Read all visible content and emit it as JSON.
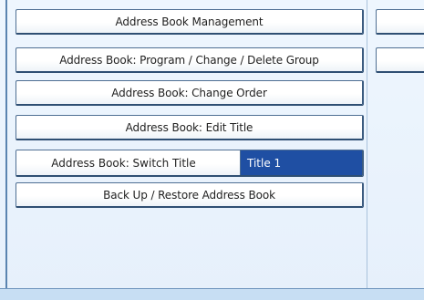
{
  "menu": {
    "address_book_management": "Address Book Management",
    "program_change_delete_group": "Address Book: Program / Change / Delete Group",
    "change_order": "Address Book: Change Order",
    "edit_title": "Address Book: Edit Title",
    "switch_title_label": "Address Book: Switch Title",
    "switch_title_value": "Title 1",
    "backup_restore": "Back Up / Restore Address Book"
  },
  "colors": {
    "selected_value_bg": "#1f4fa3",
    "panel_bg": "#e9f2fc",
    "button_border": "#4f6f93"
  }
}
